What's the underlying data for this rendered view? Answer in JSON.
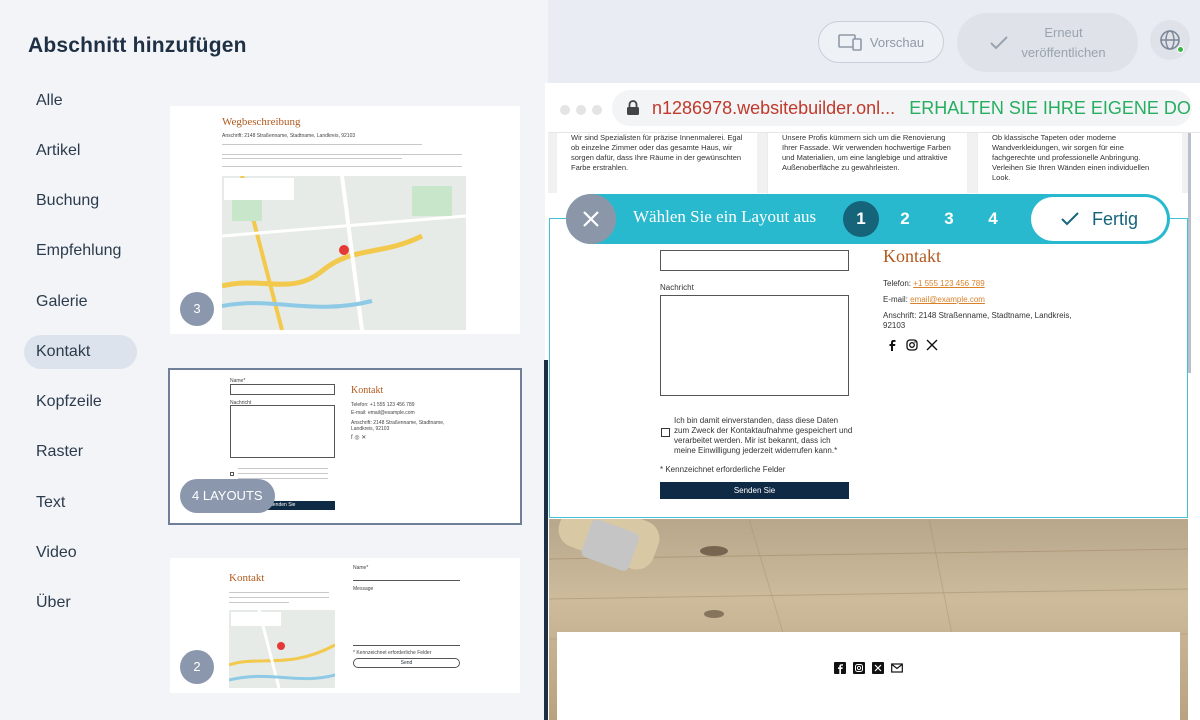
{
  "header": {
    "title": "Abschnitt hinzufügen"
  },
  "categories": [
    {
      "label": "Alle"
    },
    {
      "label": "Artikel"
    },
    {
      "label": "Buchung"
    },
    {
      "label": "Empfehlung"
    },
    {
      "label": "Galerie"
    },
    {
      "label": "Kontakt"
    },
    {
      "label": "Kopfzeile"
    },
    {
      "label": "Raster"
    },
    {
      "label": "Text"
    },
    {
      "label": "Video"
    },
    {
      "label": "Über"
    }
  ],
  "active_category": "Kontakt",
  "thumbnails": [
    {
      "title": "Wegbeschreibung",
      "badge": "3",
      "address": "Anschrift: 2148 Straßenname, Stadtname, Landkreis, 92103"
    },
    {
      "badge": "4 LAYOUTS",
      "contact_title": "Kontakt",
      "name_label": "Name*",
      "message_label": "Nachricht",
      "send_label": "Senden Sie",
      "phone": "Telefon: +1 555 123 456 789",
      "email": "E-mail: email@example.com",
      "address": "Anschrift: 2148 Straßenname, Stadtname, Landkreis, 92103"
    },
    {
      "title": "Kontakt",
      "badge": "2",
      "name_label": "Name*",
      "message_label": "Message",
      "required_note": "* Kennzeichnet erforderliche Felder",
      "send_label": "Send"
    }
  ],
  "toolbar": {
    "preview_label": "Vorschau",
    "publish_label_1": "Erneut",
    "publish_label_2": "veröffentlichen"
  },
  "browser": {
    "url": "n1286978.websitebuilder.onl...",
    "promo": "ERHALTEN SIE IHRE EIGENE DO..."
  },
  "services": [
    "Wir sind Spezialisten für präzise Innenmalerei. Egal ob einzelne Zimmer oder das gesamte Haus, wir sorgen dafür, dass Ihre Räume in der gewünschten Farbe erstrahlen.",
    "Unsere Profis kümmern sich um die Renovierung Ihrer Fassade. Wir verwenden hochwertige Farben und Materialien, um eine langlebige und attraktive Außenoberfläche zu gewährleisten.",
    "Ob klassische Tapeten oder moderne Wandverkleidungen, wir sorgen für eine fachgerechte und professionelle Anbringung. Verleihen Sie Ihren Wänden einen individuellen Look."
  ],
  "layout_picker": {
    "label": "Wählen Sie ein Layout aus",
    "options": [
      "1",
      "2",
      "3",
      "4"
    ],
    "active": "1",
    "done_label": "Fertig"
  },
  "contact_form": {
    "message_label": "Nachricht",
    "consent": "Ich bin damit einverstanden, dass diese Daten zum Zweck der Kontaktaufnahme gespeichert und verarbeitet werden. Mir ist bekannt, dass ich meine Einwilligung jederzeit widerrufen kann.*",
    "required_note": "* Kennzeichnet erforderliche Felder",
    "send_label": "Senden Sie"
  },
  "contact_info": {
    "title": "Kontakt",
    "phone_label": "Telefon:",
    "phone": "+1 555 123 456 789",
    "email_label": "E-mail:",
    "email": "email@example.com",
    "address_1": "Anschrift: 2148 Straßenname, Stadtname, Landkreis,",
    "address_2": "92103"
  },
  "colors": {
    "accent": "#29b9ce",
    "accent_dark": "#16647a",
    "brand_orange": "#b15a1e"
  }
}
